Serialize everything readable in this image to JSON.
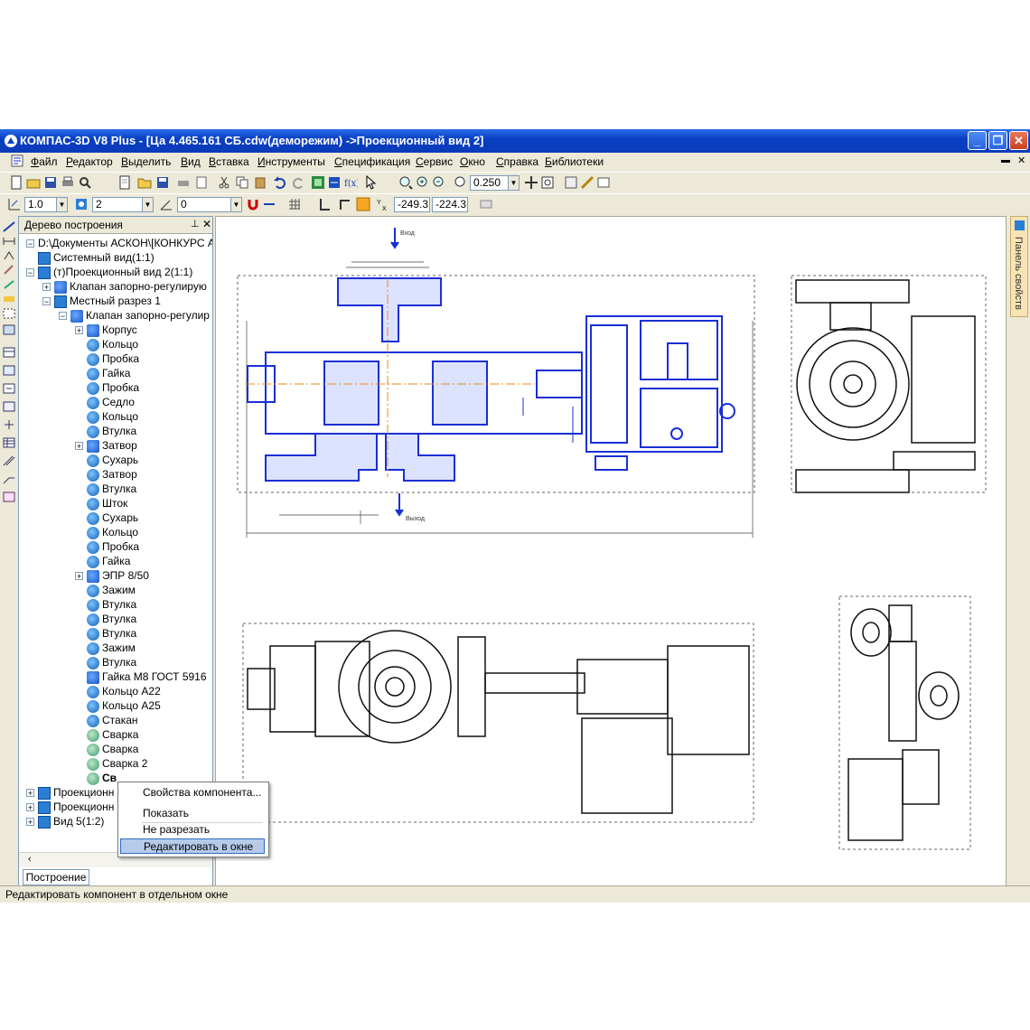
{
  "window": {
    "title": "КОМПАС-3D V8 Plus - [Ца 4.465.161 СБ.cdw(деморежим) ->Проекционный вид 2]",
    "buttons": [
      "_",
      "❐",
      "✕"
    ]
  },
  "menu": {
    "items": [
      "Файл",
      "Редактор",
      "Выделить",
      "Вид",
      "Вставка",
      "Инструменты",
      "Спецификация",
      "Сервис",
      "Окно",
      "Справка",
      "Библиотеки"
    ]
  },
  "toolbar1": {
    "zoom_value": "0.250"
  },
  "toolbar2": {
    "step_value": "1.0",
    "layer_value": "2",
    "angle_value": "0",
    "coord_x": "-249.3",
    "coord_y": "-224.3"
  },
  "tree": {
    "title": "Дерево построения",
    "tab_label": "Построение",
    "items": [
      {
        "label": "D:\\Документы АСКОН\\[КОНКУРС АС"
      },
      {
        "label": "Системный вид(1:1)"
      },
      {
        "label": "(т)Проекционный вид 2(1:1)"
      },
      {
        "label": "Клапан запорно-регулирую"
      },
      {
        "label": "Местный разрез 1"
      },
      {
        "label": "Клапан запорно-регулир"
      },
      {
        "label": "Корпус"
      },
      {
        "label": "Кольцо"
      },
      {
        "label": "Пробка"
      },
      {
        "label": "Гайка"
      },
      {
        "label": "Пробка"
      },
      {
        "label": "Седло"
      },
      {
        "label": "Кольцо"
      },
      {
        "label": "Втулка"
      },
      {
        "label": "Затвор"
      },
      {
        "label": "Сухарь"
      },
      {
        "label": "Затвор"
      },
      {
        "label": "Втулка"
      },
      {
        "label": "Шток"
      },
      {
        "label": "Сухарь"
      },
      {
        "label": "Кольцо"
      },
      {
        "label": "Пробка"
      },
      {
        "label": "Гайка"
      },
      {
        "label": "ЭПР 8/50"
      },
      {
        "label": "Зажим"
      },
      {
        "label": "Втулка"
      },
      {
        "label": "Втулка"
      },
      {
        "label": "Втулка"
      },
      {
        "label": "Зажим"
      },
      {
        "label": "Втулка"
      },
      {
        "label": "Гайка М8 ГОСТ 5916"
      },
      {
        "label": "Кольцо А22"
      },
      {
        "label": "Кольцо А25"
      },
      {
        "label": "Стакан"
      },
      {
        "label": "Сварка"
      },
      {
        "label": "Сварка"
      },
      {
        "label": "Сварка 2"
      },
      {
        "label": "Св"
      },
      {
        "label": "Проекционн"
      },
      {
        "label": "Проекционн"
      },
      {
        "label": "Вид 5(1:2)"
      }
    ]
  },
  "context_menu": {
    "items": [
      "Свойства компонента...",
      "Показать",
      "Не разрезать",
      "Редактировать в окне"
    ]
  },
  "right_panel": {
    "tab_label": "Панель свойств"
  },
  "drawing": {
    "labels": [
      "Вход",
      "Выход"
    ]
  },
  "status_bar": {
    "text": "Редактировать компонент в отдельном окне"
  },
  "colors": {
    "accent": "#0a3fc4",
    "drawing_blue": "#1a2fd6",
    "selection": "#b6cbe9"
  }
}
